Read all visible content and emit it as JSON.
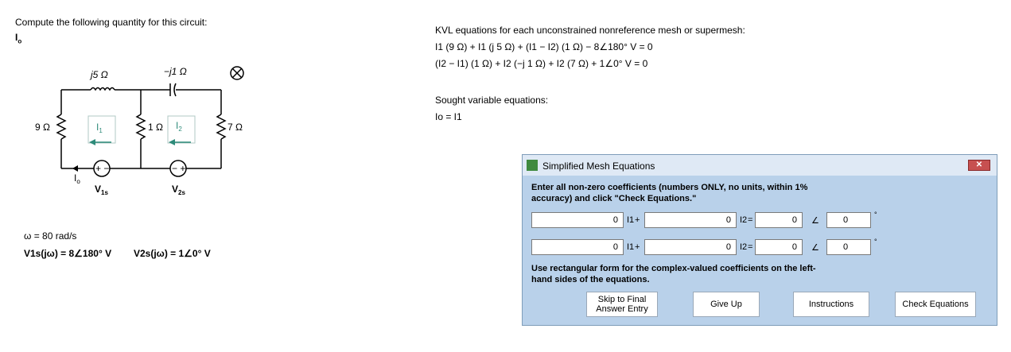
{
  "problem": {
    "prompt": "Compute the following quantity for this circuit:",
    "quantity": "I",
    "quantity_sub": "o"
  },
  "circuit": {
    "inductor_label": "j5 Ω",
    "capacitor_label": "−j1 Ω",
    "r_left": "9 Ω",
    "r_mid": "1 Ω",
    "r_right": "7 Ω",
    "mesh1": "I",
    "mesh1_sub": "1",
    "mesh2": "I",
    "mesh2_sub": "2",
    "io_label": "I",
    "io_sub": "o",
    "v1_label": "V",
    "v1_sub": "1s",
    "v2_label": "V",
    "v2_sub": "2s",
    "v1_polarity": "+ −",
    "v2_polarity": "− +"
  },
  "given": {
    "omega": "ω = 80 rad/s",
    "v1": "V1s(jω) = 8∠180° V",
    "v2": "V2s(jω) = 1∠0° V"
  },
  "equations": {
    "kvl_title": "KVL equations for each unconstrained nonreference mesh or supermesh:",
    "kvl_1": "I1 (9 Ω) + I1 (j 5 Ω) + (I1 − I2) (1 Ω) − 8∠180° V = 0",
    "kvl_2": "(I2 − I1) (1 Ω) + I2 (−j 1 Ω) + I2 (7 Ω) + 1∠0° V = 0",
    "sought_title": "Sought variable equations:",
    "sought_1": "Io = I1"
  },
  "dialog": {
    "title": "Simplified Mesh Equations",
    "instructions": "Enter all non-zero coefficients (numbers ONLY, no units, within 1% accuracy) and click \"Check Equations.\"",
    "note": "Use rectangular form for the complex-valued coefficients on the left-hand sides of the equations.",
    "close_label": "✕",
    "rows": [
      {
        "c1": "0",
        "v1": "I1",
        "plus": "+",
        "c2": "0",
        "v2": "I2",
        "eq": "=",
        "mag": "0",
        "angle_sym": "∠",
        "ang": "0",
        "deg": "°"
      },
      {
        "c1": "0",
        "v1": "I1",
        "plus": "+",
        "c2": "0",
        "v2": "I2",
        "eq": "=",
        "mag": "0",
        "angle_sym": "∠",
        "ang": "0",
        "deg": "°"
      }
    ],
    "buttons": {
      "skip": "Skip to Final Answer Entry",
      "give_up": "Give Up",
      "instructions": "Instructions",
      "check": "Check Equations"
    }
  },
  "colors": {
    "dialog_bg": "#b9d1ea",
    "mesh_arrow": "#2e8b7a",
    "close_red": "#c75050"
  }
}
